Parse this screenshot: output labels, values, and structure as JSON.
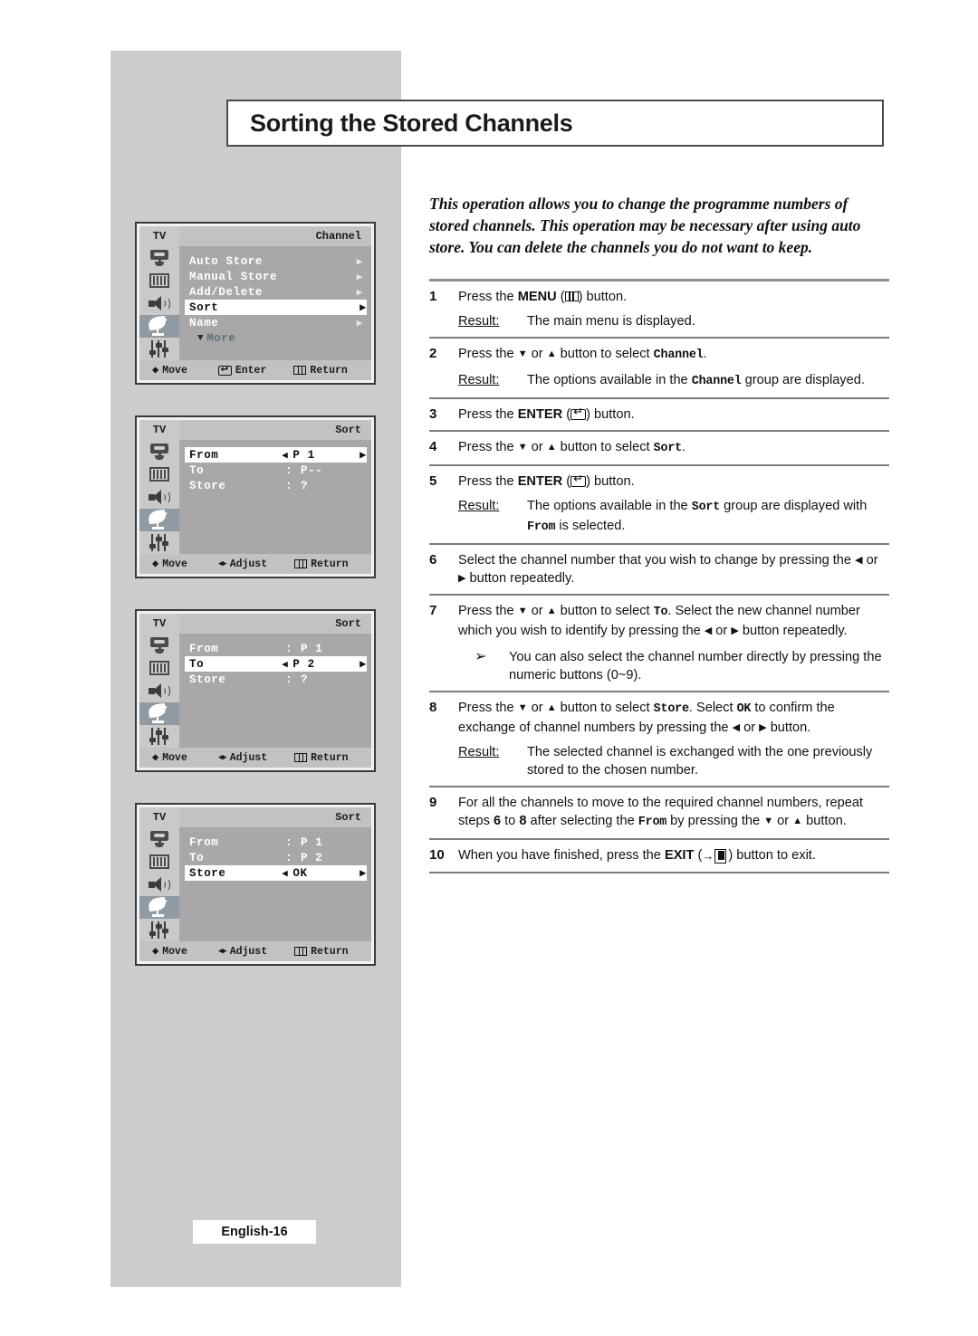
{
  "page": {
    "title": "Sorting the Stored Channels",
    "intro": "This operation allows you to change the programme numbers of stored channels. This operation may be necessary after using auto store. You can delete the channels you do not want to keep.",
    "footer_badge": "English-16"
  },
  "osd_panels": [
    {
      "device_label": "TV",
      "screen_title": "Channel",
      "rows": [
        {
          "label": "Auto Store",
          "value": "",
          "highlight": false,
          "right_caret": true,
          "adjust": false
        },
        {
          "label": "Manual Store",
          "value": "",
          "highlight": false,
          "right_caret": true,
          "adjust": false
        },
        {
          "label": "Add/Delete",
          "value": "",
          "highlight": false,
          "right_caret": true,
          "adjust": false
        },
        {
          "label": "Sort",
          "value": "",
          "highlight": true,
          "right_caret": true,
          "adjust": false
        },
        {
          "label": "Name",
          "value": "",
          "highlight": false,
          "right_caret": true,
          "adjust": false
        }
      ],
      "more_label": "More",
      "has_more": true,
      "hints": [
        {
          "icon": "updown-arrow-icon",
          "glyph": "♦",
          "label": "Move"
        },
        {
          "icon": "enter-button-icon",
          "glyph": "",
          "label": "Enter"
        },
        {
          "icon": "menu-button-icon",
          "glyph": "",
          "label": "Return"
        }
      ]
    },
    {
      "device_label": "TV",
      "screen_title": "Sort",
      "rows": [
        {
          "label": "From",
          "value": "P 1",
          "highlight": true,
          "right_caret": false,
          "adjust": true
        },
        {
          "label": "To",
          "value": "P--",
          "highlight": false,
          "right_caret": false,
          "adjust": false
        },
        {
          "label": "Store",
          "value": "?",
          "highlight": false,
          "right_caret": false,
          "adjust": false
        }
      ],
      "more_label": "",
      "has_more": false,
      "hints": [
        {
          "icon": "updown-arrow-icon",
          "glyph": "♦",
          "label": "Move"
        },
        {
          "icon": "leftright-arrow-icon",
          "glyph": "",
          "label": "Adjust"
        },
        {
          "icon": "menu-button-icon",
          "glyph": "",
          "label": "Return"
        }
      ]
    },
    {
      "device_label": "TV",
      "screen_title": "Sort",
      "rows": [
        {
          "label": "From",
          "value": "P 1",
          "highlight": false,
          "right_caret": false,
          "adjust": false
        },
        {
          "label": "To",
          "value": "P 2",
          "highlight": true,
          "right_caret": false,
          "adjust": true
        },
        {
          "label": "Store",
          "value": "?",
          "highlight": false,
          "right_caret": false,
          "adjust": false
        }
      ],
      "more_label": "",
      "has_more": false,
      "hints": [
        {
          "icon": "updown-arrow-icon",
          "glyph": "♦",
          "label": "Move"
        },
        {
          "icon": "leftright-arrow-icon",
          "glyph": "",
          "label": "Adjust"
        },
        {
          "icon": "menu-button-icon",
          "glyph": "",
          "label": "Return"
        }
      ]
    },
    {
      "device_label": "TV",
      "screen_title": "Sort",
      "rows": [
        {
          "label": "From",
          "value": "P 1",
          "highlight": false,
          "right_caret": false,
          "adjust": false
        },
        {
          "label": "To",
          "value": "P 2",
          "highlight": false,
          "right_caret": false,
          "adjust": false
        },
        {
          "label": "Store",
          "value": "OK",
          "highlight": true,
          "right_caret": false,
          "adjust": true
        }
      ],
      "more_label": "",
      "has_more": false,
      "hints": [
        {
          "icon": "updown-arrow-icon",
          "glyph": "♦",
          "label": "Move"
        },
        {
          "icon": "leftright-arrow-icon",
          "glyph": "",
          "label": "Adjust"
        },
        {
          "icon": "menu-button-icon",
          "glyph": "",
          "label": "Return"
        }
      ]
    }
  ],
  "osd_sidebar_icons": [
    {
      "name": "picture-icon",
      "selected": false
    },
    {
      "name": "bars-icon",
      "selected": false
    },
    {
      "name": "speaker-icon",
      "selected": false
    },
    {
      "name": "satellite-dish-icon",
      "selected": true
    },
    {
      "name": "equalizer-icon",
      "selected": false
    }
  ],
  "steps": [
    {
      "num": "1",
      "html": "Press the <b class=\"k\">MENU</b> (<span class=\"ic-menu\" data-name=\"menu-button-icon\"></span>) button.",
      "result_label": "Result:",
      "result": "The main menu is displayed."
    },
    {
      "num": "2",
      "html": "Press the <span class=\"arrowglyph\">▼</span> or <span class=\"arrowglyph\">▲</span> button to select <span class=\"mono\">Channel</span>.",
      "result_label": "Result:",
      "result_html": "The options available in the <span class=\"mono\">Channel</span> group are displayed."
    },
    {
      "num": "3",
      "html": "Press the <b class=\"k\">ENTER</b> (<span class=\"ic-enter\" data-name=\"enter-button-icon\"></span>) button."
    },
    {
      "num": "4",
      "html": "Press the <span class=\"arrowglyph\">▼</span> or <span class=\"arrowglyph\">▲</span> button to select <span class=\"mono\">Sort</span>."
    },
    {
      "num": "5",
      "html": "Press the <b class=\"k\">ENTER</b> (<span class=\"ic-enter\" data-name=\"enter-button-icon\"></span>) button.",
      "result_label": "Result:",
      "result_html": "The options available in the <span class=\"mono\">Sort</span> group are displayed with <span class=\"mono\">From</span> is selected."
    },
    {
      "num": "6",
      "html": "Select the channel number that you wish to change by pressing the <span class=\"arrowglyph\">◀</span> or <span class=\"arrowglyph\">▶</span> button repeatedly."
    },
    {
      "num": "7",
      "html": "Press the <span class=\"arrowglyph\">▼</span> or <span class=\"arrowglyph\">▲</span> button to select <span class=\"mono\">To</span>. Select the new channel number which you wish to identify by pressing the <span class=\"arrowglyph\">◀</span> or <span class=\"arrowglyph\">▶</span> button repeatedly.",
      "note": "You can also select the channel number directly by pressing the numeric buttons (0~9).",
      "note_glyph": "➢"
    },
    {
      "num": "8",
      "html": "Press the <span class=\"arrowglyph\">▼</span> or <span class=\"arrowglyph\">▲</span> button to select <span class=\"mono\">Store</span>. Select <span class=\"mono\">OK</span> to confirm the exchange of channel numbers by pressing the <span class=\"arrowglyph\">◀</span> or <span class=\"arrowglyph\">▶</span> button.",
      "result_label": "Result:",
      "result": "The selected channel is exchanged with the one previously stored to the chosen number."
    },
    {
      "num": "9",
      "html": "For all the channels to move to the required channel numbers, repeat steps <b class=\"k\">6</b> to <b class=\"k\">8</b> after selecting the <span class=\"mono\">From</span> by pressing the <span class=\"arrowglyph\">▼</span> or <span class=\"arrowglyph\">▲</span> button."
    },
    {
      "num": "10",
      "html": "When you have finished, press the <b class=\"k\">EXIT</b> (<span class=\"exit-arrow\">→</span><span class=\"ic-exit\" data-name=\"exit-button-icon\"></span> ) button to exit."
    }
  ]
}
